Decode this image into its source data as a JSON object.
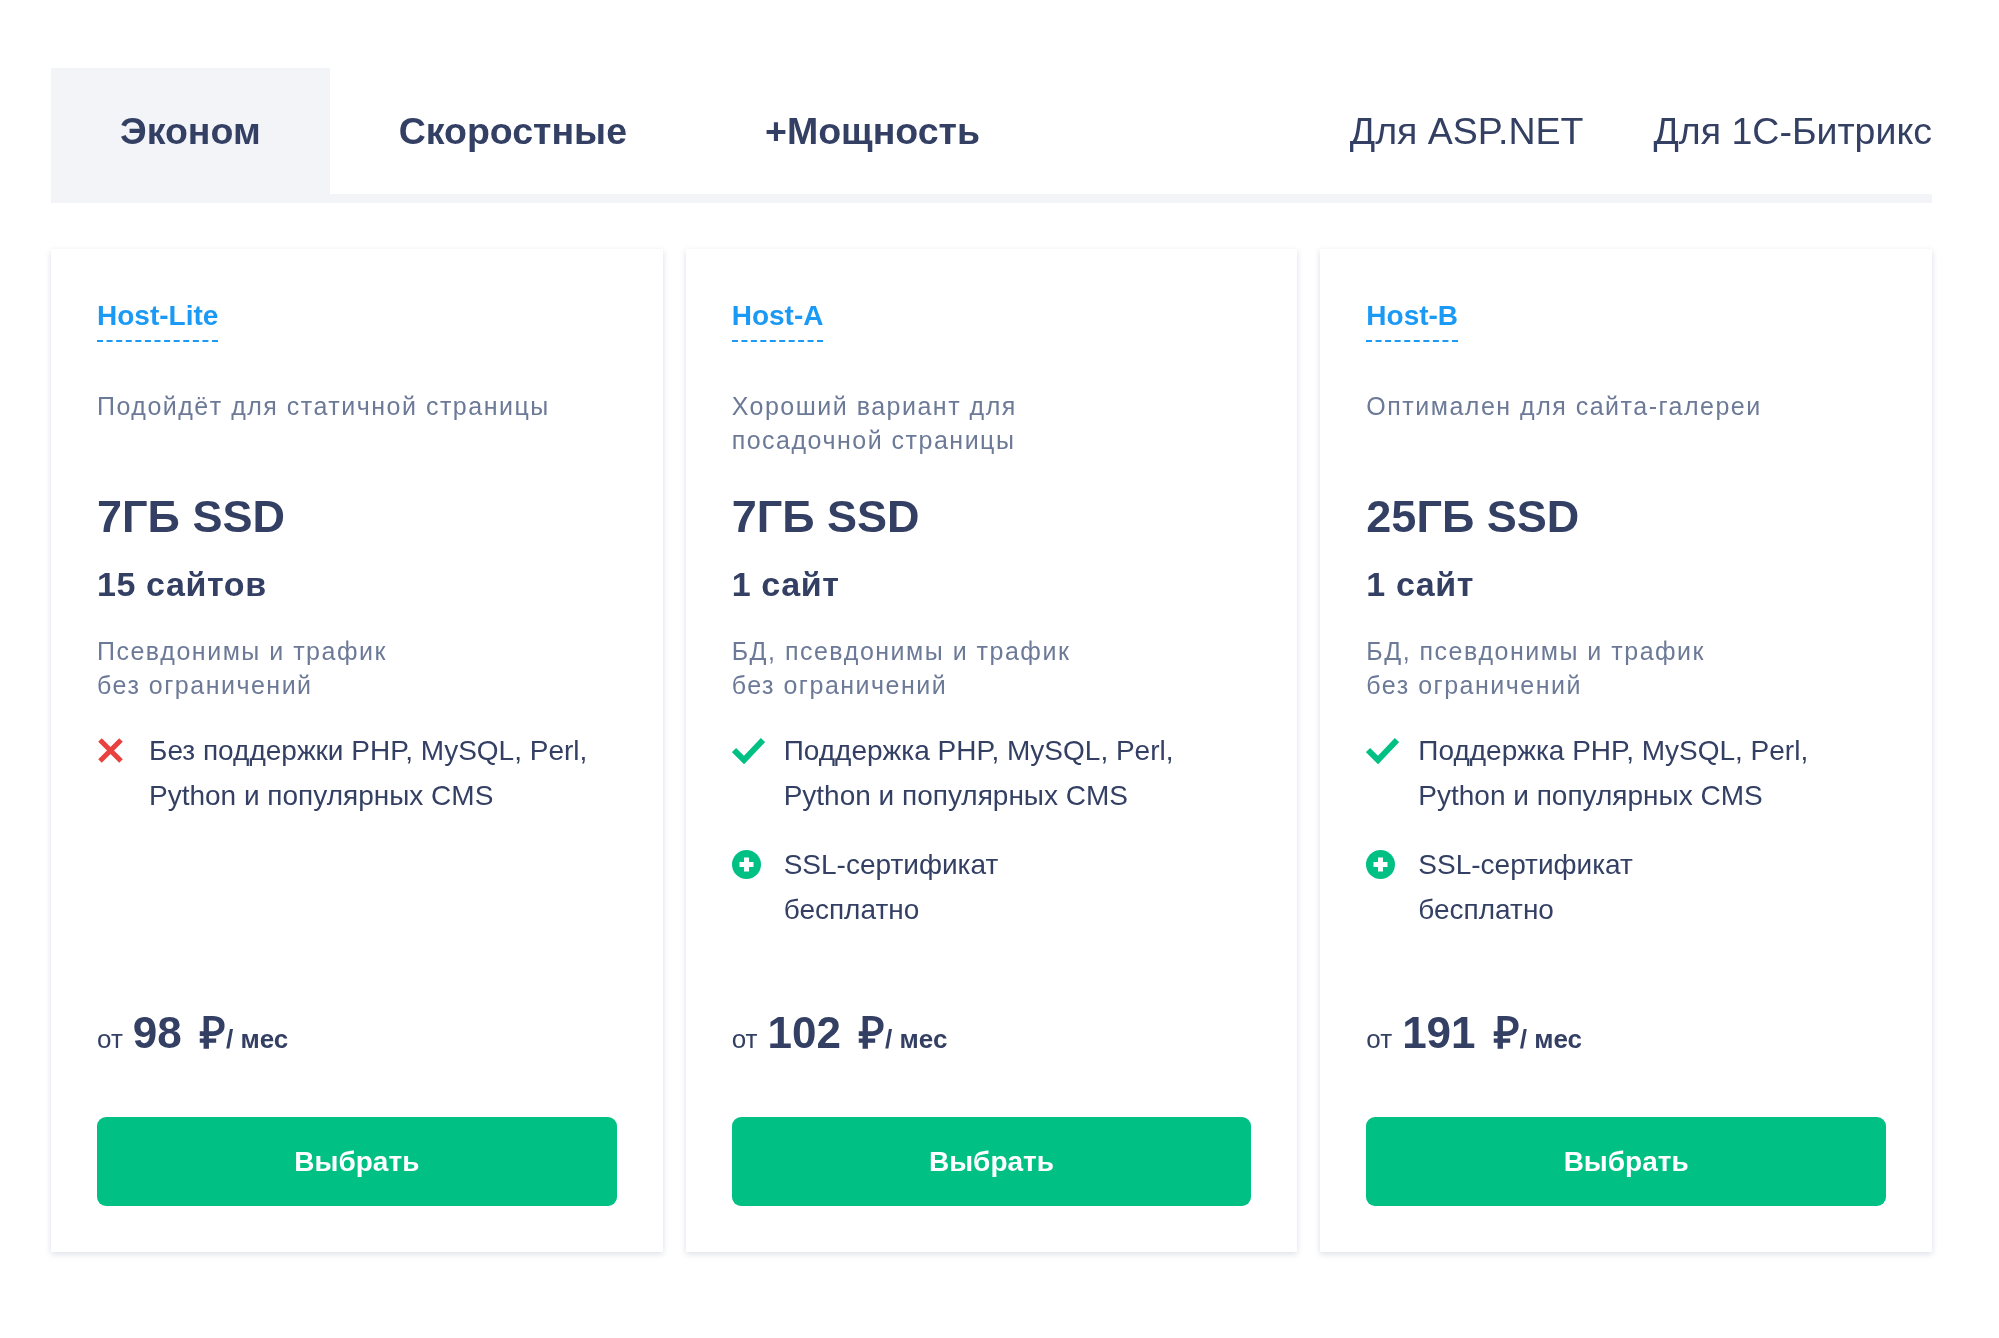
{
  "tabs": [
    {
      "label": "Эконом",
      "kind": "main",
      "selected": true
    },
    {
      "label": "Скоростные",
      "kind": "main",
      "selected": false
    },
    {
      "label": "+Мощность",
      "kind": "main",
      "selected": false
    },
    {
      "label": "Для ASP.NET",
      "kind": "link",
      "selected": false
    },
    {
      "label": "Для 1С-Битрикс",
      "kind": "link",
      "selected": false
    }
  ],
  "plans": [
    {
      "name": "Host-Lite",
      "description": "Подойдёт для статичной страницы",
      "disk": "7ГБ SSD",
      "sites": "15 сайтов",
      "limits": "Псевдонимы и трафик\nбез ограничений",
      "features": [
        {
          "kind": "excluded",
          "text": "Без поддержки PHP, MySQL, Perl,\nPython и популярных CMS"
        }
      ],
      "price": {
        "prefix": "от",
        "amount": "98 ₽",
        "period": "/ мес"
      },
      "button": "Выбрать"
    },
    {
      "name": "Host-A",
      "description": "Хороший вариант для\nпосадочной страницы",
      "disk": "7ГБ SSD",
      "sites": "1 сайт",
      "limits": "БД, псевдонимы и трафик\nбез ограничений",
      "features": [
        {
          "kind": "included",
          "text": "Поддержка PHP, MySQL, Perl,\nPython и популярных CMS"
        },
        {
          "kind": "bonus",
          "text": "SSL-сертификат\nбесплатно"
        }
      ],
      "price": {
        "prefix": "от",
        "amount": "102 ₽",
        "period": "/ мес"
      },
      "button": "Выбрать"
    },
    {
      "name": "Host-B",
      "description": "Оптимален для сайта-галереи",
      "disk": "25ГБ SSD",
      "sites": "1 сайт",
      "limits": "БД, псевдонимы и трафик\nбез ограничений",
      "features": [
        {
          "kind": "included",
          "text": "Поддержка PHP, MySQL, Perl,\nPython и популярных CMS"
        },
        {
          "kind": "bonus",
          "text": "SSL-сертификат\nбесплатно"
        }
      ],
      "price": {
        "prefix": "от",
        "amount": "191 ₽",
        "period": "/ мес"
      },
      "button": "Выбрать"
    }
  ]
}
